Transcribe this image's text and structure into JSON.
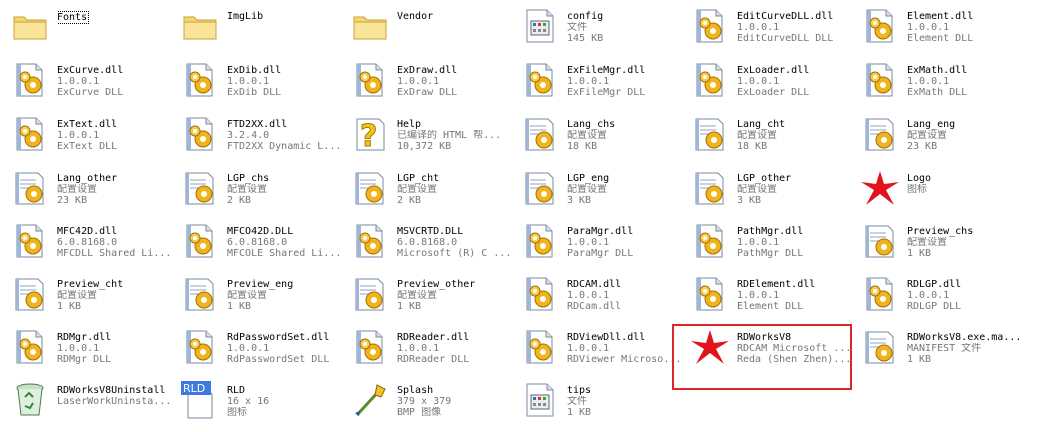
{
  "window": {
    "selection_color": "#e0262b",
    "folder_color": "#f5d76e",
    "dll_gear_color": "#f0b41c",
    "text_secondary_color": "#777777"
  },
  "files": [
    {
      "name": "Fonts",
      "lines": [],
      "icon": "folder-icon",
      "focused": true
    },
    {
      "name": "ImgLib",
      "lines": [],
      "icon": "folder-icon"
    },
    {
      "name": "Vendor",
      "lines": [],
      "icon": "folder-icon"
    },
    {
      "name": "config",
      "lines": [
        "文件",
        "145 KB"
      ],
      "icon": "file-icon"
    },
    {
      "name": "EditCurveDLL.dll",
      "lines": [
        "1.0.0.1",
        "EditCurveDLL DLL"
      ],
      "icon": "dll-icon"
    },
    {
      "name": "Element.dll",
      "lines": [
        "1.0.0.1",
        "Element DLL"
      ],
      "icon": "dll-icon"
    },
    {
      "name": "ExCurve.dll",
      "lines": [
        "1.0.0.1",
        "ExCurve DLL"
      ],
      "icon": "dll-icon"
    },
    {
      "name": "ExDib.dll",
      "lines": [
        "1.0.0.1",
        "ExDib DLL"
      ],
      "icon": "dll-icon"
    },
    {
      "name": "ExDraw.dll",
      "lines": [
        "1.0.0.1",
        "ExDraw DLL"
      ],
      "icon": "dll-icon"
    },
    {
      "name": "ExFileMgr.dll",
      "lines": [
        "1.0.0.1",
        "ExFileMgr DLL"
      ],
      "icon": "dll-icon"
    },
    {
      "name": "ExLoader.dll",
      "lines": [
        "1.0.0.1",
        "ExLoader DLL"
      ],
      "icon": "dll-icon"
    },
    {
      "name": "ExMath.dll",
      "lines": [
        "1.0.0.1",
        "ExMath DLL"
      ],
      "icon": "dll-icon"
    },
    {
      "name": "ExText.dll",
      "lines": [
        "1.0.0.1",
        "ExText DLL"
      ],
      "icon": "dll-icon"
    },
    {
      "name": "FTD2XX.dll",
      "lines": [
        "3.2.4.0",
        "FTD2XX Dynamic L..."
      ],
      "icon": "dll-icon"
    },
    {
      "name": "Help",
      "lines": [
        "已编译的 HTML 帮...",
        "10,372 KB"
      ],
      "icon": "help-icon"
    },
    {
      "name": "Lang_chs",
      "lines": [
        "配置设置",
        "18 KB"
      ],
      "icon": "ini-icon"
    },
    {
      "name": "Lang_cht",
      "lines": [
        "配置设置",
        "18 KB"
      ],
      "icon": "ini-icon"
    },
    {
      "name": "Lang_eng",
      "lines": [
        "配置设置",
        "23 KB"
      ],
      "icon": "ini-icon"
    },
    {
      "name": "Lang_other",
      "lines": [
        "配置设置",
        "23 KB"
      ],
      "icon": "ini-icon"
    },
    {
      "name": "LGP_chs",
      "lines": [
        "配置设置",
        "2 KB"
      ],
      "icon": "ini-icon"
    },
    {
      "name": "LGP_cht",
      "lines": [
        "配置设置",
        "2 KB"
      ],
      "icon": "ini-icon"
    },
    {
      "name": "LGP_eng",
      "lines": [
        "配置设置",
        "3 KB"
      ],
      "icon": "ini-icon"
    },
    {
      "name": "LGP_other",
      "lines": [
        "配置设置",
        "3 KB"
      ],
      "icon": "ini-icon"
    },
    {
      "name": "Logo",
      "lines": [
        "图标"
      ],
      "icon": "logo-icon"
    },
    {
      "name": "MFC42D.dll",
      "lines": [
        "6.0.8168.0",
        "MFCDLL Shared Li..."
      ],
      "icon": "dll-icon"
    },
    {
      "name": "MFCO42D.DLL",
      "lines": [
        "6.0.8168.0",
        "MFCOLE Shared Li..."
      ],
      "icon": "dll-icon"
    },
    {
      "name": "MSVCRTD.DLL",
      "lines": [
        "6.0.8168.0",
        "Microsoft (R) C ..."
      ],
      "icon": "dll-icon"
    },
    {
      "name": "ParaMgr.dll",
      "lines": [
        "1.0.0.1",
        "ParaMgr DLL"
      ],
      "icon": "dll-icon"
    },
    {
      "name": "PathMgr.dll",
      "lines": [
        "1.0.0.1",
        "PathMgr DLL"
      ],
      "icon": "dll-icon"
    },
    {
      "name": "Preview_chs",
      "lines": [
        "配置设置",
        "1 KB"
      ],
      "icon": "ini-icon"
    },
    {
      "name": "Preview_cht",
      "lines": [
        "配置设置",
        "1 KB"
      ],
      "icon": "ini-icon"
    },
    {
      "name": "Preview_eng",
      "lines": [
        "配置设置",
        "1 KB"
      ],
      "icon": "ini-icon"
    },
    {
      "name": "Preview_other",
      "lines": [
        "配置设置",
        "1 KB"
      ],
      "icon": "ini-icon"
    },
    {
      "name": "RDCAM.dll",
      "lines": [
        "1.0.0.1",
        "RDCam.dll"
      ],
      "icon": "dll-icon"
    },
    {
      "name": "RDElement.dll",
      "lines": [
        "1.0.0.1",
        "Element DLL"
      ],
      "icon": "dll-icon"
    },
    {
      "name": "RDLGP.dll",
      "lines": [
        "1.0.0.1",
        "RDLGP DLL"
      ],
      "icon": "dll-icon"
    },
    {
      "name": "RDMgr.dll",
      "lines": [
        "1.0.0.1",
        "RDMgr DLL"
      ],
      "icon": "dll-icon"
    },
    {
      "name": "RdPasswordSet.dll",
      "lines": [
        "1.0.0.1",
        "RdPasswordSet DLL"
      ],
      "icon": "dll-icon"
    },
    {
      "name": "RDReader.dll",
      "lines": [
        "1.0.0.1",
        "RDReader DLL"
      ],
      "icon": "dll-icon"
    },
    {
      "name": "RDViewDll.dll",
      "lines": [
        "1.0.0.1",
        "RDViewer Microso..."
      ],
      "icon": "dll-icon"
    },
    {
      "name": "RDWorksV8",
      "lines": [
        "RDCAM Microsoft ...",
        "Reda (Shen Zhen)..."
      ],
      "icon": "logo-icon",
      "selected": true
    },
    {
      "name": "RDWorksV8.exe.ma...",
      "lines": [
        "MANIFEST 文件",
        "1 KB"
      ],
      "icon": "ini-icon"
    },
    {
      "name": "RDWorksV8Uninstall",
      "lines": [
        "LaserWorkUninsta..."
      ],
      "icon": "bin-icon"
    },
    {
      "name": "RLD",
      "lines": [
        "16 x 16",
        "图标"
      ],
      "icon": "rld-icon"
    },
    {
      "name": "Splash",
      "lines": [
        "379 x 379",
        "BMP 图像"
      ],
      "icon": "bmp-icon"
    },
    {
      "name": "tips",
      "lines": [
        "文件",
        "1 KB"
      ],
      "icon": "file-icon"
    }
  ]
}
